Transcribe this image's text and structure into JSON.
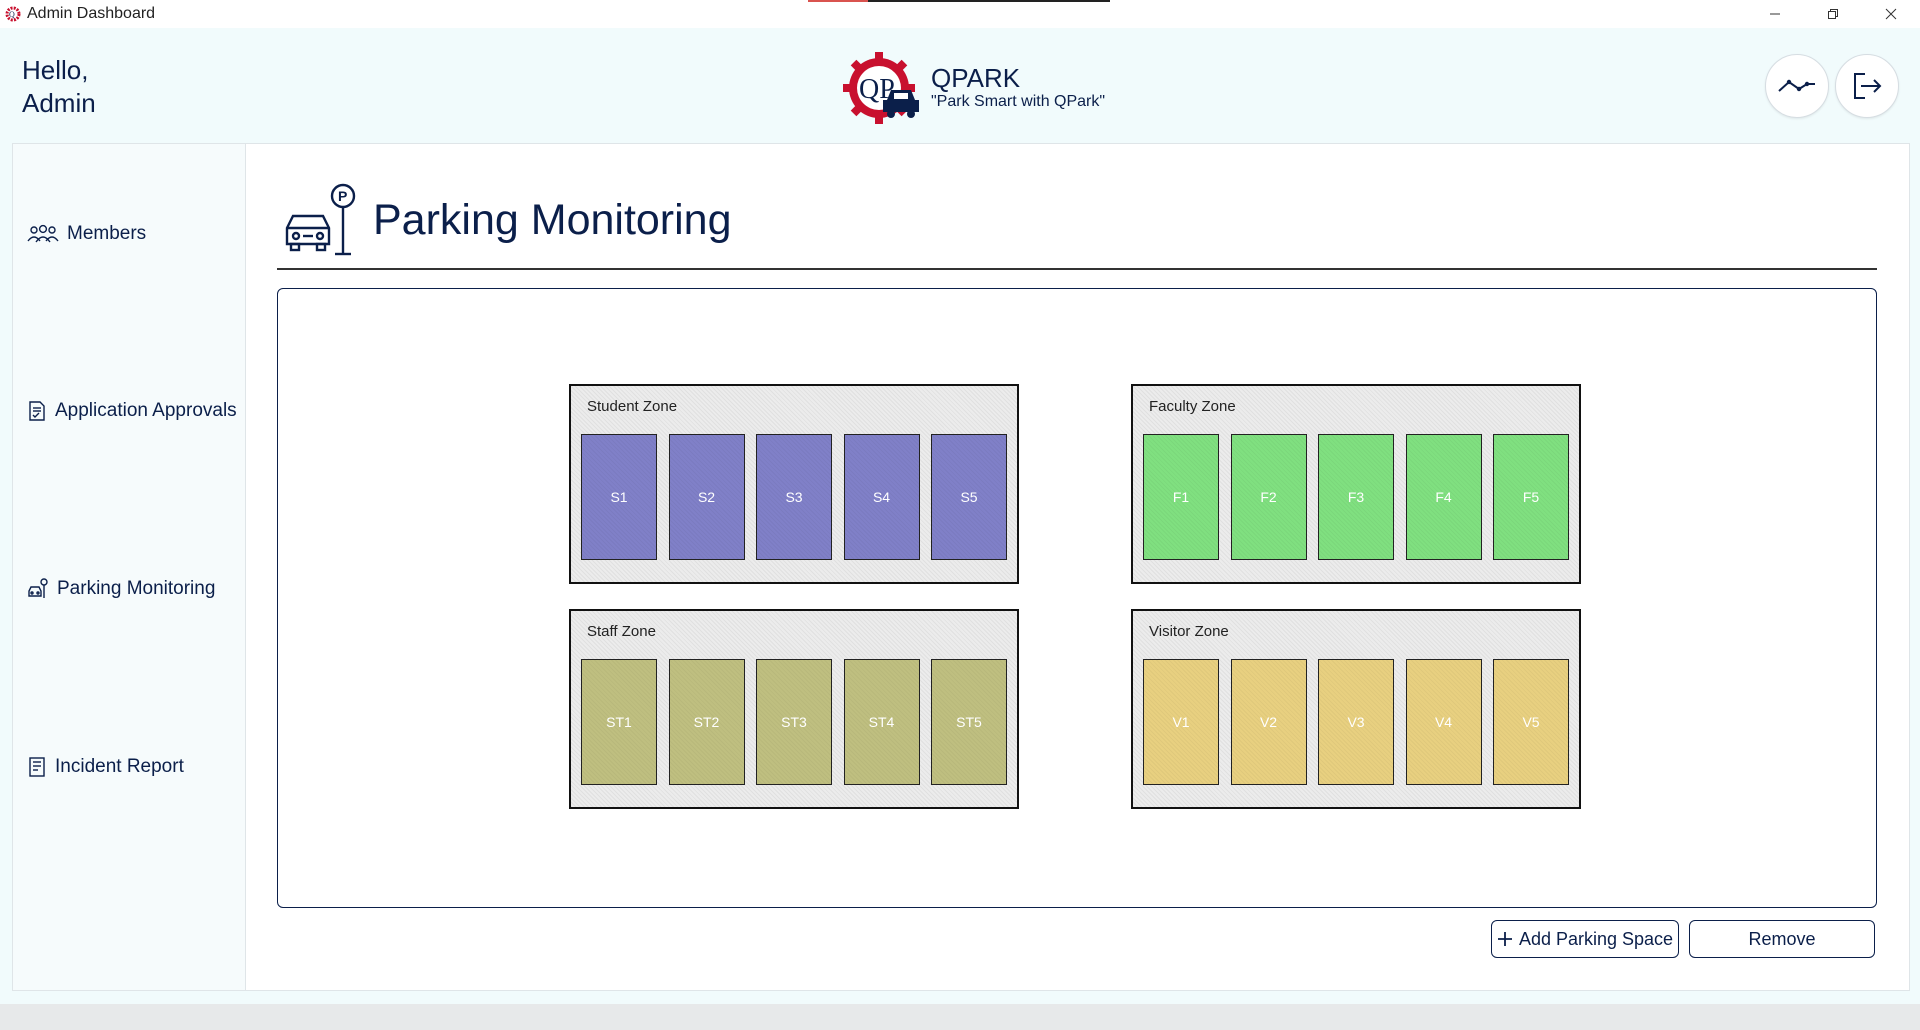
{
  "window": {
    "title": "Admin Dashboard"
  },
  "header": {
    "greeting_line1": "Hello,",
    "greeting_line2": "Admin",
    "brand_name": "QPARK",
    "brand_tagline": "\"Park Smart with QPark\"",
    "logo_letters": "QP",
    "actions": [
      {
        "name": "analytics-button",
        "icon": "trend-line-icon"
      },
      {
        "name": "logout-button",
        "icon": "logout-icon"
      }
    ]
  },
  "sidebar": {
    "items": [
      {
        "label": "Members",
        "icon": "people-icon"
      },
      {
        "label": "Application Approvals",
        "icon": "approvals-document-icon"
      },
      {
        "label": "Parking Monitoring",
        "icon": "car-parking-icon"
      },
      {
        "label": "Incident Report",
        "icon": "report-icon"
      }
    ]
  },
  "page": {
    "title": "Parking Monitoring",
    "title_icon": "car-parking-sign-icon"
  },
  "zones": [
    {
      "name": "Student Zone",
      "color": "#8080c8",
      "slots": [
        "S1",
        "S2",
        "S3",
        "S4",
        "S5"
      ]
    },
    {
      "name": "Faculty Zone",
      "color": "#80e080",
      "slots": [
        "F1",
        "F2",
        "F3",
        "F4",
        "F5"
      ]
    },
    {
      "name": "Staff Zone",
      "color": "#bfbf80",
      "slots": [
        "ST1",
        "ST2",
        "ST3",
        "ST4",
        "ST5"
      ]
    },
    {
      "name": "Visitor Zone",
      "color": "#e8d080",
      "slots": [
        "V1",
        "V2",
        "V3",
        "V4",
        "V5"
      ]
    }
  ],
  "actions": {
    "add_label": "Add Parking Space",
    "remove_label": "Remove"
  },
  "colors": {
    "primary_text": "#0b1f4a",
    "header_bg": "#f1fbfc",
    "logo_red": "#c8102e"
  }
}
